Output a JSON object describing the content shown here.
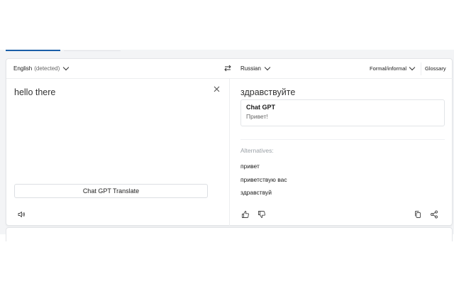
{
  "source": {
    "language": "English",
    "detected_suffix": "(detected)",
    "text": "hello there",
    "translate_button": "Chat GPT Translate"
  },
  "target": {
    "language": "Russian",
    "text": "здравствуйте",
    "formality": "Formal/informal",
    "glossary": "Glossary",
    "gpt_label": "Chat GPT",
    "gpt_result": "Привет!",
    "alternatives_label": "Alternatives:",
    "alternatives": [
      "привет",
      "приветствую вас",
      "здравствуй"
    ]
  },
  "colors": {
    "accent": "#1a5ea8",
    "background": "#f3f4f6",
    "border": "#e3e5e8"
  }
}
